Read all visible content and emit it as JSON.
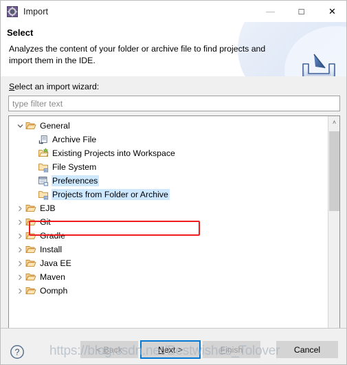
{
  "window": {
    "title": "Import",
    "icon": "eclipse-gear-icon",
    "controls": {
      "minimize": "—",
      "maximize": "□",
      "close": "✕"
    }
  },
  "header": {
    "title": "Select",
    "description": "Analyzes the content of your folder or archive file to find projects and import them in the IDE.",
    "banner_icon": "import-tray-arrow-icon"
  },
  "body": {
    "wizard_label_accesskey": "S",
    "wizard_label_rest": "elect an import wizard:",
    "filter": {
      "value": "",
      "placeholder": "type filter text"
    }
  },
  "tree": {
    "items": [
      {
        "label": "General",
        "icon": "folder-open-icon",
        "indent": 0,
        "arrow": "expanded",
        "state": "normal"
      },
      {
        "label": "Archive File",
        "icon": "archive-file-icon",
        "indent": 1,
        "arrow": "none",
        "state": "normal"
      },
      {
        "label": "Existing Projects into Workspace",
        "icon": "existing-projects-icon",
        "indent": 1,
        "arrow": "none",
        "state": "normal"
      },
      {
        "label": "File System",
        "icon": "file-system-icon",
        "indent": 1,
        "arrow": "none",
        "state": "normal"
      },
      {
        "label": "Preferences",
        "icon": "preferences-icon",
        "indent": 1,
        "arrow": "none",
        "state": "selected"
      },
      {
        "label": "Projects from Folder or Archive",
        "icon": "file-system-icon",
        "indent": 1,
        "arrow": "none",
        "state": "selected"
      },
      {
        "label": "EJB",
        "icon": "folder-open-icon",
        "indent": 0,
        "arrow": "collapsed",
        "state": "normal"
      },
      {
        "label": "Git",
        "icon": "folder-open-icon",
        "indent": 0,
        "arrow": "collapsed",
        "state": "normal"
      },
      {
        "label": "Gradle",
        "icon": "folder-open-icon",
        "indent": 0,
        "arrow": "collapsed",
        "state": "normal"
      },
      {
        "label": "Install",
        "icon": "folder-open-icon",
        "indent": 0,
        "arrow": "collapsed",
        "state": "normal"
      },
      {
        "label": "Java EE",
        "icon": "folder-open-icon",
        "indent": 0,
        "arrow": "collapsed",
        "state": "normal"
      },
      {
        "label": "Maven",
        "icon": "folder-open-icon",
        "indent": 0,
        "arrow": "collapsed",
        "state": "normal"
      },
      {
        "label": "Oomph",
        "icon": "folder-open-icon",
        "indent": 0,
        "arrow": "collapsed",
        "state": "normal"
      }
    ],
    "highlight_index": 5,
    "scrollbar": {
      "up": "˄",
      "down": "˅"
    }
  },
  "footer": {
    "help_icon": "help-question-icon",
    "buttons": [
      {
        "id": "back",
        "label_pre": "< ",
        "accesskey": "B",
        "label_post": "ack",
        "enabled": false,
        "focused": false
      },
      {
        "id": "next",
        "label_pre": "",
        "accesskey": "N",
        "label_post": "ext >",
        "enabled": true,
        "focused": true
      },
      {
        "id": "finish",
        "label_pre": "",
        "accesskey": "F",
        "label_post": "inish",
        "enabled": false,
        "focused": false
      },
      {
        "id": "cancel",
        "label_pre": "",
        "accesskey": "",
        "label_post": "Cancel",
        "enabled": true,
        "focused": false
      }
    ]
  },
  "watermark": {
    "text": "https://blog.csdn.net/Bestwishes_Tolover"
  },
  "colors": {
    "accent": "#0078d7",
    "marker": "#ee1c1c",
    "selection": "#cde8ff",
    "chrome": "#f0f0f0"
  }
}
